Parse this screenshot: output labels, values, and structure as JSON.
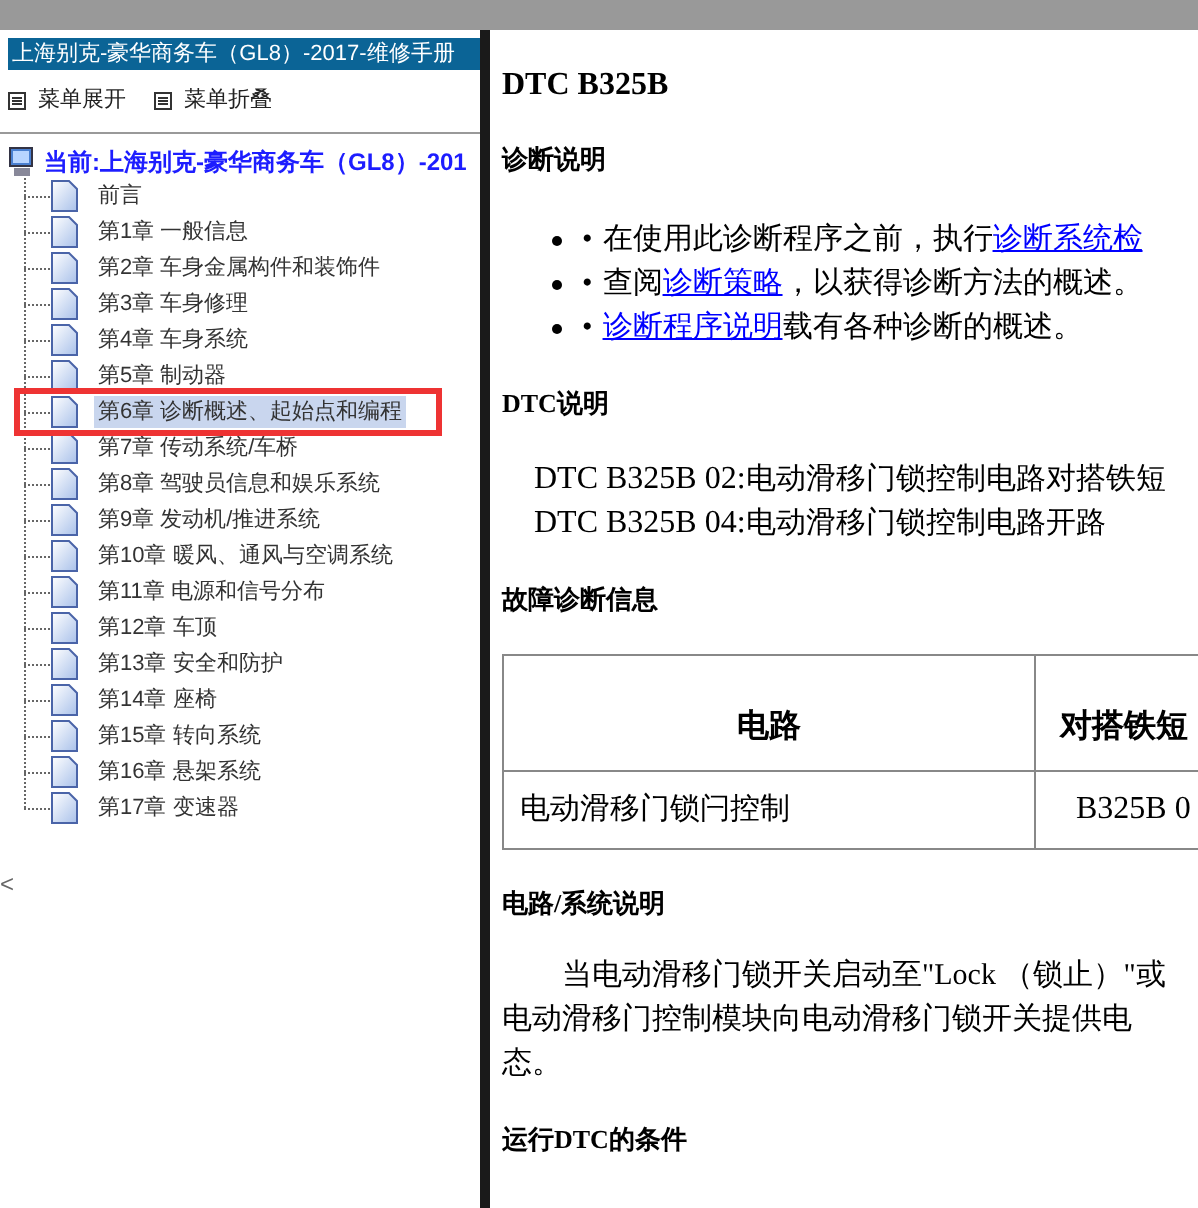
{
  "sidebar": {
    "title": "上海别克-豪华商务车（GL8）-2017-维修手册",
    "menu": [
      {
        "label": "菜单展开"
      },
      {
        "label": "菜单折叠"
      }
    ],
    "tree": {
      "label": "当前:上海别克-豪华商务车（GL8）-201",
      "children": [
        {
          "label": "前言",
          "selected": false
        },
        {
          "label": "第1章 一般信息",
          "selected": false
        },
        {
          "label": "第2章 车身金属构件和装饰件",
          "selected": false
        },
        {
          "label": "第3章 车身修理",
          "selected": false
        },
        {
          "label": "第4章 车身系统",
          "selected": false
        },
        {
          "label": "第5章 制动器",
          "selected": false
        },
        {
          "label": "第6章 诊断概述、起始点和编程",
          "selected": true
        },
        {
          "label": "第7章 传动系统/车桥",
          "selected": false
        },
        {
          "label": "第8章 驾驶员信息和娱乐系统",
          "selected": false
        },
        {
          "label": "第9章 发动机/推进系统",
          "selected": false
        },
        {
          "label": "第10章 暖风、通风与空调系统",
          "selected": false
        },
        {
          "label": "第11章 电源和信号分布",
          "selected": false
        },
        {
          "label": "第12章 车顶",
          "selected": false
        },
        {
          "label": "第13章 安全和防护",
          "selected": false
        },
        {
          "label": "第14章 座椅",
          "selected": false
        },
        {
          "label": "第15章 转向系统",
          "selected": false
        },
        {
          "label": "第16章 悬架系统",
          "selected": false
        },
        {
          "label": "第17章 变速器",
          "selected": false
        }
      ]
    },
    "scroll_arrow": "<"
  },
  "content": {
    "title": "DTC B325B",
    "sections": [
      {
        "kind": "bullets",
        "heading": "诊断说明",
        "items": [
          {
            "bullet": "•",
            "parts": [
              {
                "text": "在使用此诊断程序之前，执行",
                "link": false
              },
              {
                "text": "诊断系统检",
                "link": true
              }
            ]
          },
          {
            "bullet": "•",
            "parts": [
              {
                "text": "查阅",
                "link": false
              },
              {
                "text": "诊断策略",
                "link": true
              },
              {
                "text": "，以获得诊断方法的概述。",
                "link": false
              }
            ]
          },
          {
            "bullet": "•",
            "parts": [
              {
                "text": "诊断程序说明",
                "link": true
              },
              {
                "text": "载有各种诊断的概述。",
                "link": false
              }
            ]
          }
        ]
      },
      {
        "kind": "codes",
        "heading": "DTC说明",
        "lines": [
          {
            "code": "DTC B325B 02:",
            "text": "电动滑移门锁控制电路对搭铁短"
          },
          {
            "code": "DTC B325B 04:",
            "text": "电动滑移门锁控制电路开路"
          }
        ]
      },
      {
        "kind": "table",
        "heading": "故障诊断信息",
        "columns": [
          "电路",
          "对搭铁短"
        ],
        "rows": [
          [
            "电动滑移门锁闩控制",
            "B325B 0"
          ]
        ]
      },
      {
        "kind": "paragraph",
        "heading": "电路/系统说明",
        "lines": [
          "当电动滑移门锁开关启动至\"Lock （锁止）\"或",
          "电动滑移门控制模块向电动滑移门锁开关提供电",
          "态。"
        ]
      },
      {
        "kind": "heading_only",
        "heading": "运行DTC的条件"
      }
    ]
  }
}
